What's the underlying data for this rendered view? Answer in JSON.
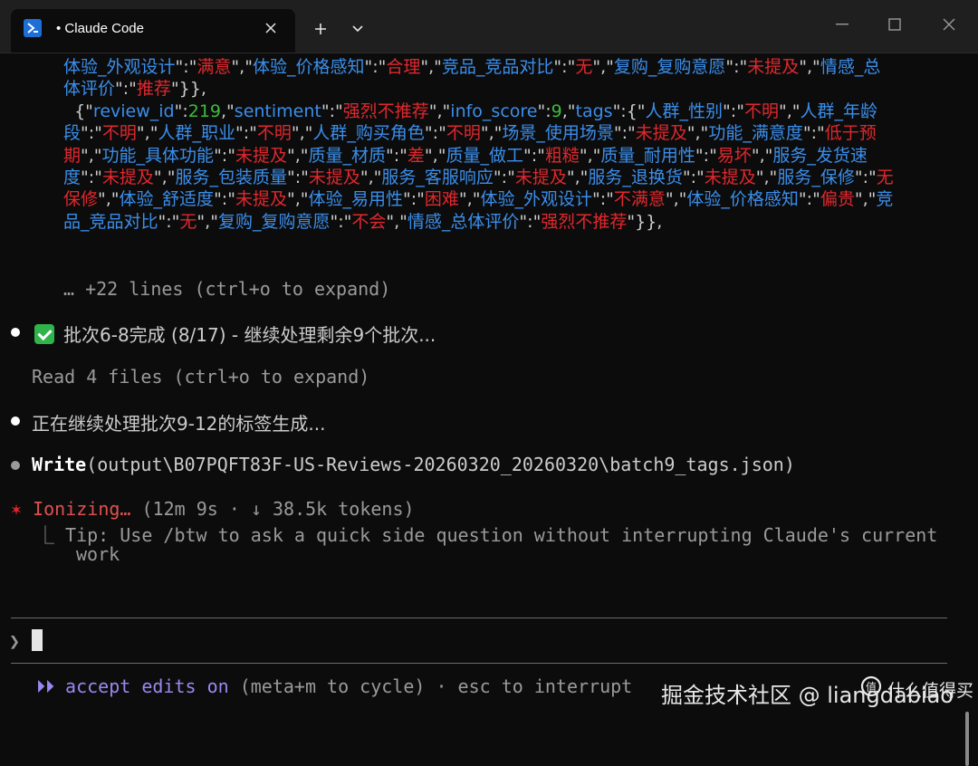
{
  "window": {
    "tab_title": "• Claude Code",
    "colors": {
      "accent": "#9a88f0",
      "string": "#e0282e",
      "key": "#3b8eea",
      "number": "#3cbc3c"
    }
  },
  "json_block": [
    [
      [
        "k",
        "体验_外观设计"
      ],
      [
        "p",
        "\":\""
      ],
      [
        "s",
        "满意"
      ],
      [
        "p",
        "\",\""
      ],
      [
        "k",
        "体验_价格感知"
      ],
      [
        "p",
        "\":\""
      ],
      [
        "s",
        "合理"
      ],
      [
        "p",
        "\",\""
      ],
      [
        "k",
        "竞品_竞品对比"
      ],
      [
        "p",
        "\":\""
      ],
      [
        "s",
        "无"
      ],
      [
        "p",
        "\",\""
      ],
      [
        "k",
        "复购_复购意愿"
      ],
      [
        "p",
        "\":\""
      ],
      [
        "s",
        "未提及"
      ],
      [
        "p",
        "\",\""
      ],
      [
        "k",
        "情感_总体评价"
      ],
      [
        "p",
        "\":\""
      ],
      [
        "s",
        "推荐"
      ],
      [
        "p",
        "\"}},"
      ]
    ],
    [
      [
        "p",
        "  {\""
      ],
      [
        "k",
        "review_id"
      ],
      [
        "p",
        "\":"
      ],
      [
        "n",
        "219"
      ],
      [
        "p",
        ",\""
      ],
      [
        "k",
        "sentiment"
      ],
      [
        "p",
        "\":\""
      ],
      [
        "s",
        "强烈不推荐"
      ],
      [
        "p",
        "\",\""
      ],
      [
        "k",
        "info_score"
      ],
      [
        "p",
        "\":"
      ],
      [
        "n",
        "9"
      ],
      [
        "p",
        ",\""
      ],
      [
        "k",
        "tags"
      ],
      [
        "p",
        "\":{\""
      ],
      [
        "k",
        "人群_性别"
      ],
      [
        "p",
        "\":\""
      ],
      [
        "s",
        "不明"
      ],
      [
        "p",
        "\",\""
      ],
      [
        "k",
        "人群_年龄段"
      ],
      [
        "p",
        "\":\""
      ],
      [
        "s",
        "不明"
      ],
      [
        "p",
        "\",\""
      ],
      [
        "k",
        "人群_职业"
      ],
      [
        "p",
        "\":\""
      ],
      [
        "s",
        "不明"
      ],
      [
        "p",
        "\",\""
      ],
      [
        "k",
        "人群_购买角色"
      ],
      [
        "p",
        "\":\""
      ],
      [
        "s",
        "不明"
      ],
      [
        "p",
        "\",\""
      ],
      [
        "k",
        "场景_使用场景"
      ],
      [
        "p",
        "\":\""
      ],
      [
        "s",
        "未提及"
      ],
      [
        "p",
        "\",\""
      ],
      [
        "k",
        "功能_满意度"
      ],
      [
        "p",
        "\":\""
      ],
      [
        "s",
        "低于预期"
      ],
      [
        "p",
        "\",\""
      ],
      [
        "k",
        "功能_具体功能"
      ],
      [
        "p",
        "\":\""
      ],
      [
        "s",
        "未提及"
      ],
      [
        "p",
        "\",\""
      ],
      [
        "k",
        "质量_材质"
      ],
      [
        "p",
        "\":\""
      ],
      [
        "s",
        "差"
      ],
      [
        "p",
        "\",\""
      ],
      [
        "k",
        "质量_做工"
      ],
      [
        "p",
        "\":\""
      ],
      [
        "s",
        "粗糙"
      ],
      [
        "p",
        "\",\""
      ],
      [
        "k",
        "质量_耐用性"
      ],
      [
        "p",
        "\":\""
      ],
      [
        "s",
        "易坏"
      ],
      [
        "p",
        "\",\""
      ],
      [
        "k",
        "服务_发货速度"
      ],
      [
        "p",
        "\":\""
      ],
      [
        "s",
        "未提及"
      ],
      [
        "p",
        "\",\""
      ],
      [
        "k",
        "服务_包装质量"
      ],
      [
        "p",
        "\":\""
      ],
      [
        "s",
        "未提及"
      ],
      [
        "p",
        "\",\""
      ],
      [
        "k",
        "服务_客服响应"
      ],
      [
        "p",
        "\":\""
      ],
      [
        "s",
        "未提及"
      ],
      [
        "p",
        "\",\""
      ],
      [
        "k",
        "服务_退换货"
      ],
      [
        "p",
        "\":\""
      ],
      [
        "s",
        "未提及"
      ],
      [
        "p",
        "\",\""
      ],
      [
        "k",
        "服务_保修"
      ],
      [
        "p",
        "\":\""
      ],
      [
        "s",
        "无保修"
      ],
      [
        "p",
        "\",\""
      ],
      [
        "k",
        "体验_舒适度"
      ],
      [
        "p",
        "\":\""
      ],
      [
        "s",
        "未提及"
      ],
      [
        "p",
        "\",\""
      ],
      [
        "k",
        "体验_易用性"
      ],
      [
        "p",
        "\":\""
      ],
      [
        "s",
        "困难"
      ],
      [
        "p",
        "\",\""
      ],
      [
        "k",
        "体验_外观设计"
      ],
      [
        "p",
        "\":\""
      ],
      [
        "s",
        "不满意"
      ],
      [
        "p",
        "\",\""
      ],
      [
        "k",
        "体验_价格感知"
      ],
      [
        "p",
        "\":\""
      ],
      [
        "s",
        "偏贵"
      ],
      [
        "p",
        "\",\""
      ],
      [
        "k",
        "竞品_竞品对比"
      ],
      [
        "p",
        "\":\""
      ],
      [
        "s",
        "无"
      ],
      [
        "p",
        "\",\""
      ],
      [
        "k",
        "复购_复购意愿"
      ],
      [
        "p",
        "\":\""
      ],
      [
        "s",
        "不会"
      ],
      [
        "p",
        "\",\""
      ],
      [
        "k",
        "情感_总体评价"
      ],
      [
        "p",
        "\":\""
      ],
      [
        "s",
        "强烈不推荐"
      ],
      [
        "p",
        "\"}},"
      ]
    ]
  ],
  "expand_hint": "… +22 lines (ctrl+o to expand)",
  "batch_done": "批次6-8完成 (8/17) - 继续处理剩余9个批次...",
  "read_files": "Read 4 files (ctrl+o to expand)",
  "continuing": "正在继续处理批次9-12的标签生成...",
  "write_tool": "Write",
  "write_path": "(output\\B07PQFT83F-US-Reviews-20260320_20260320\\batch9_tags.json)",
  "status": {
    "star": "✶",
    "verb": "Ionizing…",
    "meta": "(12m 9s · ↓ 38.5k tokens)"
  },
  "tip_prefix": "⎿",
  "tip_line1": "Tip: Use /btw to ask a quick side question without interrupting Claude's current",
  "tip_line2": "work",
  "prompt_symbol": "❯",
  "mode": {
    "arrows": "⏵⏵",
    "label": "accept edits on",
    "hint": "(meta+m to cycle) · esc to interrupt"
  },
  "watermark": "掘金技术社区 @ liangdabiao",
  "brand_text": "什么值得买"
}
